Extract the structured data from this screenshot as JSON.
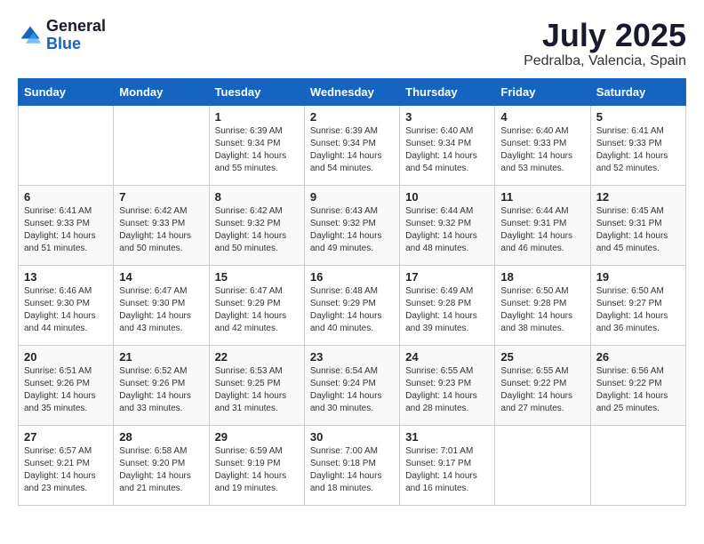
{
  "logo": {
    "general": "General",
    "blue": "Blue"
  },
  "title": {
    "month_year": "July 2025",
    "location": "Pedralba, Valencia, Spain"
  },
  "weekdays": [
    "Sunday",
    "Monday",
    "Tuesday",
    "Wednesday",
    "Thursday",
    "Friday",
    "Saturday"
  ],
  "weeks": [
    [
      {
        "day": "",
        "info": ""
      },
      {
        "day": "",
        "info": ""
      },
      {
        "day": "1",
        "info": "Sunrise: 6:39 AM\nSunset: 9:34 PM\nDaylight: 14 hours and 55 minutes."
      },
      {
        "day": "2",
        "info": "Sunrise: 6:39 AM\nSunset: 9:34 PM\nDaylight: 14 hours and 54 minutes."
      },
      {
        "day": "3",
        "info": "Sunrise: 6:40 AM\nSunset: 9:34 PM\nDaylight: 14 hours and 54 minutes."
      },
      {
        "day": "4",
        "info": "Sunrise: 6:40 AM\nSunset: 9:33 PM\nDaylight: 14 hours and 53 minutes."
      },
      {
        "day": "5",
        "info": "Sunrise: 6:41 AM\nSunset: 9:33 PM\nDaylight: 14 hours and 52 minutes."
      }
    ],
    [
      {
        "day": "6",
        "info": "Sunrise: 6:41 AM\nSunset: 9:33 PM\nDaylight: 14 hours and 51 minutes."
      },
      {
        "day": "7",
        "info": "Sunrise: 6:42 AM\nSunset: 9:33 PM\nDaylight: 14 hours and 50 minutes."
      },
      {
        "day": "8",
        "info": "Sunrise: 6:42 AM\nSunset: 9:32 PM\nDaylight: 14 hours and 50 minutes."
      },
      {
        "day": "9",
        "info": "Sunrise: 6:43 AM\nSunset: 9:32 PM\nDaylight: 14 hours and 49 minutes."
      },
      {
        "day": "10",
        "info": "Sunrise: 6:44 AM\nSunset: 9:32 PM\nDaylight: 14 hours and 48 minutes."
      },
      {
        "day": "11",
        "info": "Sunrise: 6:44 AM\nSunset: 9:31 PM\nDaylight: 14 hours and 46 minutes."
      },
      {
        "day": "12",
        "info": "Sunrise: 6:45 AM\nSunset: 9:31 PM\nDaylight: 14 hours and 45 minutes."
      }
    ],
    [
      {
        "day": "13",
        "info": "Sunrise: 6:46 AM\nSunset: 9:30 PM\nDaylight: 14 hours and 44 minutes."
      },
      {
        "day": "14",
        "info": "Sunrise: 6:47 AM\nSunset: 9:30 PM\nDaylight: 14 hours and 43 minutes."
      },
      {
        "day": "15",
        "info": "Sunrise: 6:47 AM\nSunset: 9:29 PM\nDaylight: 14 hours and 42 minutes."
      },
      {
        "day": "16",
        "info": "Sunrise: 6:48 AM\nSunset: 9:29 PM\nDaylight: 14 hours and 40 minutes."
      },
      {
        "day": "17",
        "info": "Sunrise: 6:49 AM\nSunset: 9:28 PM\nDaylight: 14 hours and 39 minutes."
      },
      {
        "day": "18",
        "info": "Sunrise: 6:50 AM\nSunset: 9:28 PM\nDaylight: 14 hours and 38 minutes."
      },
      {
        "day": "19",
        "info": "Sunrise: 6:50 AM\nSunset: 9:27 PM\nDaylight: 14 hours and 36 minutes."
      }
    ],
    [
      {
        "day": "20",
        "info": "Sunrise: 6:51 AM\nSunset: 9:26 PM\nDaylight: 14 hours and 35 minutes."
      },
      {
        "day": "21",
        "info": "Sunrise: 6:52 AM\nSunset: 9:26 PM\nDaylight: 14 hours and 33 minutes."
      },
      {
        "day": "22",
        "info": "Sunrise: 6:53 AM\nSunset: 9:25 PM\nDaylight: 14 hours and 31 minutes."
      },
      {
        "day": "23",
        "info": "Sunrise: 6:54 AM\nSunset: 9:24 PM\nDaylight: 14 hours and 30 minutes."
      },
      {
        "day": "24",
        "info": "Sunrise: 6:55 AM\nSunset: 9:23 PM\nDaylight: 14 hours and 28 minutes."
      },
      {
        "day": "25",
        "info": "Sunrise: 6:55 AM\nSunset: 9:22 PM\nDaylight: 14 hours and 27 minutes."
      },
      {
        "day": "26",
        "info": "Sunrise: 6:56 AM\nSunset: 9:22 PM\nDaylight: 14 hours and 25 minutes."
      }
    ],
    [
      {
        "day": "27",
        "info": "Sunrise: 6:57 AM\nSunset: 9:21 PM\nDaylight: 14 hours and 23 minutes."
      },
      {
        "day": "28",
        "info": "Sunrise: 6:58 AM\nSunset: 9:20 PM\nDaylight: 14 hours and 21 minutes."
      },
      {
        "day": "29",
        "info": "Sunrise: 6:59 AM\nSunset: 9:19 PM\nDaylight: 14 hours and 19 minutes."
      },
      {
        "day": "30",
        "info": "Sunrise: 7:00 AM\nSunset: 9:18 PM\nDaylight: 14 hours and 18 minutes."
      },
      {
        "day": "31",
        "info": "Sunrise: 7:01 AM\nSunset: 9:17 PM\nDaylight: 14 hours and 16 minutes."
      },
      {
        "day": "",
        "info": ""
      },
      {
        "day": "",
        "info": ""
      }
    ]
  ]
}
